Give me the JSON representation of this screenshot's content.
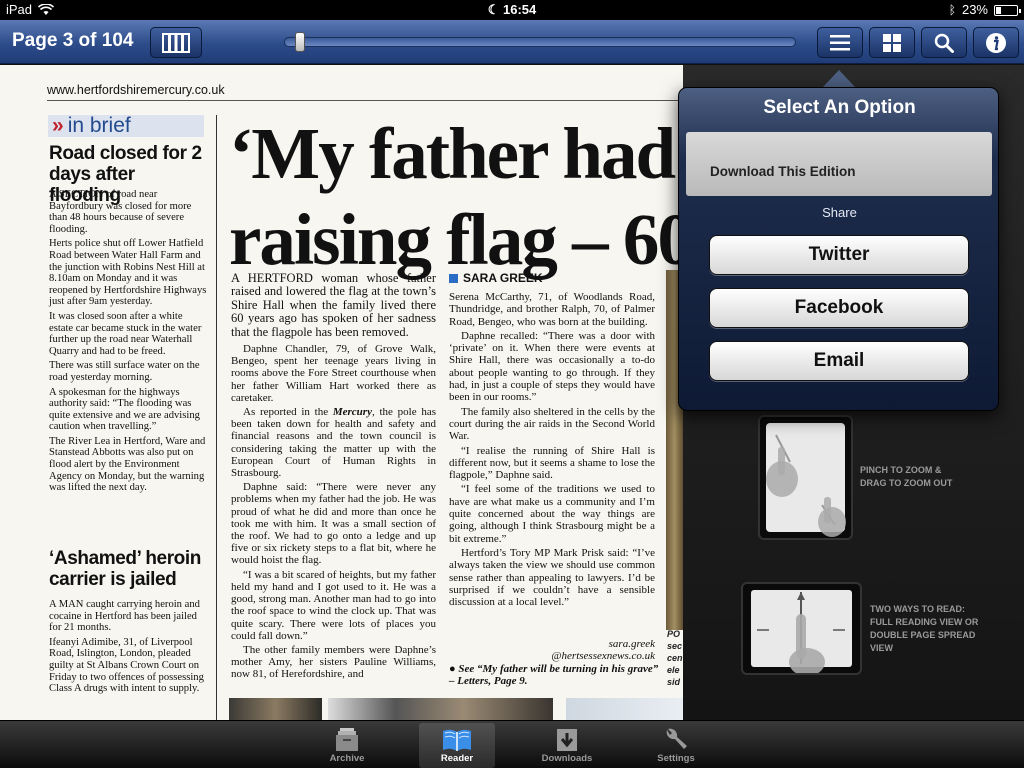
{
  "status_bar": {
    "device": "iPad",
    "time": "16:54",
    "battery": "23%",
    "battery_level": 0.23
  },
  "toolbar": {
    "page_label": "Page 3 of 104",
    "page_current": 3,
    "page_total": 104,
    "slider_position": 0.02,
    "icons": [
      "book-spread-icon",
      "list-icon",
      "grid-icon",
      "search-icon",
      "info-icon"
    ]
  },
  "newspaper": {
    "url": "www.hertfordshiremercury.co.uk",
    "brief_label": "in brief",
    "brief_stories": [
      {
        "headline": "Road closed for 2 days after flooding",
        "paras": [
          "A SECTION of road near Bayfordbury was closed for more than 48 hours because of severe flooding.",
          "Herts police shut off Lower Hatfield Road between Water Hall Farm and the junction with Robins Nest Hill at 8.10am on Monday and it was reopened by Hertfordshire Highways just after 9am yesterday.",
          "It was closed soon after a white estate car became stuck in the water further up the road near Waterhall Quarry and had to be freed.",
          "There was still surface water on the road yesterday morning.",
          "A spokesman for the highways authority said: “The flooding was quite extensive and we are advising caution when travelling.”",
          "The River Lea in Hertford, Ware and Stanstead Abbotts was also put on flood alert by the Environment Agency on Monday, but the warning was lifted the next day."
        ]
      },
      {
        "headline": "‘Ashamed’ heroin carrier is jailed",
        "paras": [
          "A MAN caught carrying heroin and cocaine in Hertford has been jailed for 21 months.",
          "Ifeanyi Adimibe, 31, of Liverpool Road, Islington, London, pleaded guilty at St Albans Crown Court on Friday to two offences of possessing Class A drugs with intent to supply."
        ]
      }
    ],
    "headline_line1": "‘My father had n",
    "headline_line2": "raising flag – 60",
    "byline": "SARA GREEK",
    "lead": "A HERTFORD woman whose father raised and lowered the flag at the town’s Shire Hall when the family lived there 60 years ago has spoken of her sadness that the flagpole has been removed.",
    "col1": [
      "Daphne Chandler, 79, of Grove Walk, Bengeo, spent her teenage years living in rooms above the Fore Street courthouse when her father William Hart worked there as caretaker.",
      "As reported in the Mercury, the pole has been taken down for health and safety and financial reasons and the town council is considering taking the matter up with the European Court of Human Rights in Strasbourg.",
      "Daphne said: “There were never any problems when my father had the job. He was proud of what he did and more than once he took me with him. It was a small section of the roof. We had to go onto a ledge and up five or six rickety steps to a flat bit, where he would hoist the flag.",
      "“I was a bit scared of heights, but my father held my hand and I got used to it. He was a good, strong man. Another man had to go into the roof space to wind the clock up. That was quite scary. There were lots of places you could fall down.”",
      "The other family members were Daphne’s mother Amy, her sisters Pauline Williams, now 81, of Herefordshire, and"
    ],
    "col2": [
      "Serena McCarthy, 71, of Woodlands Road, Thundridge, and brother Ralph, 70, of Palmer Road, Bengeo, who was born at the building.",
      "Daphne recalled: “There was a door with ‘private’ on it. When there were events at Shire Hall, there was occasionally a to-do about people wanting to go through. If they had, in just a couple of steps they would have been in our rooms.”",
      "The family also sheltered in the cells by the court during the air raids in the Second World War.",
      "“I realise the running of Shire Hall is different now, but it seems a shame to lose the flagpole,” Daphne said.",
      "“I feel some of the traditions we used to have are what make us a community and I’m quite concerned about the way things are going, although I think Strasbourg might be a bit extreme.”",
      "Hertford’s Tory MP Mark Prisk said: “I’ve always taken the view we should use common sense rather than appealing to lawyers. I’d be surprised if we couldn’t have a sensible discussion at a local level.”"
    ],
    "sig_name": "sara.greek",
    "sig_email": "@hertsessexnews.co.uk",
    "see_also": "● See “My father will be turning in his grave” – Letters, Page 9.",
    "side_caption": [
      "PO",
      "sec",
      "cen",
      "ele",
      "sid"
    ]
  },
  "help": {
    "pinch": "PINCH TO ZOOM & DRAG TO ZOOM OUT",
    "two_ways": "TWO WAYS TO READ: FULL READING VIEW OR DOUBLE PAGE SPREAD VIEW"
  },
  "popover": {
    "title": "Select An Option",
    "download": "Download This Edition",
    "share_label": "Share",
    "buttons": [
      "Twitter",
      "Facebook",
      "Email"
    ]
  },
  "tabbar": {
    "tabs": [
      {
        "label": "Archive",
        "icon": "archive-icon"
      },
      {
        "label": "Reader",
        "icon": "book-icon"
      },
      {
        "label": "Downloads",
        "icon": "download-icon"
      },
      {
        "label": "Settings",
        "icon": "wrench-icon"
      }
    ],
    "active": "Reader"
  }
}
